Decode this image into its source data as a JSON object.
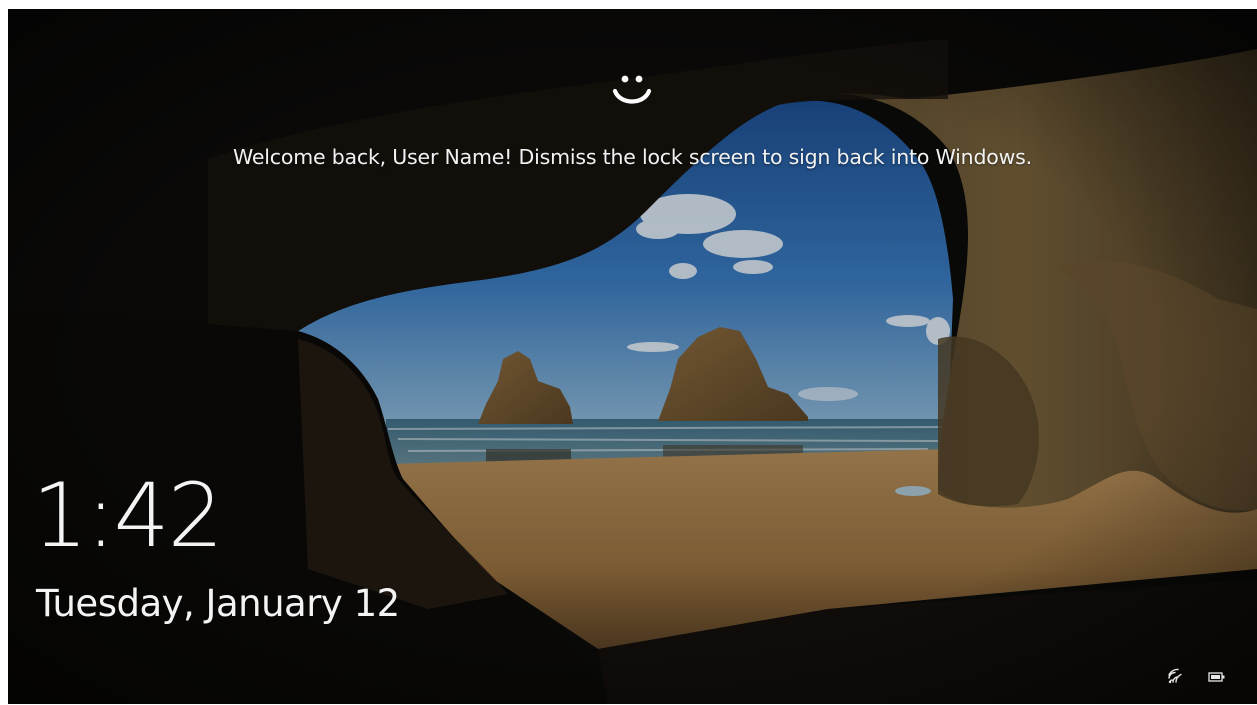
{
  "lock_screen": {
    "welcome_message": "Welcome back, User Name! Dismiss the lock screen to sign back into Windows.",
    "time": "1:42",
    "date": "Tuesday, January 12"
  },
  "icons": {
    "hello": "windows-hello-face-icon",
    "network": "wifi-signal-icon",
    "battery": "battery-icon"
  },
  "colors": {
    "text": "#f4f4f4",
    "cave_dark": "#0b0a08",
    "sky": "#3a76b8",
    "sand": "#a2794a"
  }
}
